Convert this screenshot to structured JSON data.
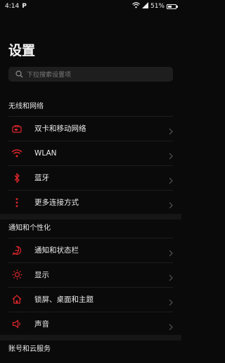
{
  "status": {
    "time": "4:14",
    "app_indicator": "P",
    "battery_text": "51%",
    "battery_level": 0.51
  },
  "page": {
    "title": "设置"
  },
  "search": {
    "placeholder": "下拉搜索设置项",
    "icon": "search-icon"
  },
  "sections": [
    {
      "header": "无线和网络",
      "items": [
        {
          "label": "双卡和移动网络",
          "icon": "sim-card-icon"
        },
        {
          "label": "WLAN",
          "icon": "wifi-icon"
        },
        {
          "label": "蓝牙",
          "icon": "bluetooth-icon"
        },
        {
          "label": "更多连接方式",
          "icon": "more-dots-icon"
        }
      ]
    },
    {
      "header": "通知和个性化",
      "items": [
        {
          "label": "通知和状态栏",
          "icon": "notification-icon"
        },
        {
          "label": "显示",
          "icon": "brightness-icon"
        },
        {
          "label": "锁屏、桌面和主题",
          "icon": "home-icon"
        },
        {
          "label": "声音",
          "icon": "speaker-icon"
        }
      ]
    },
    {
      "header": "账号和云服务",
      "items": []
    }
  ],
  "colors": {
    "accent": "#e0262c",
    "background": "#0a0a0a",
    "search_bg": "#1e1e1e"
  }
}
